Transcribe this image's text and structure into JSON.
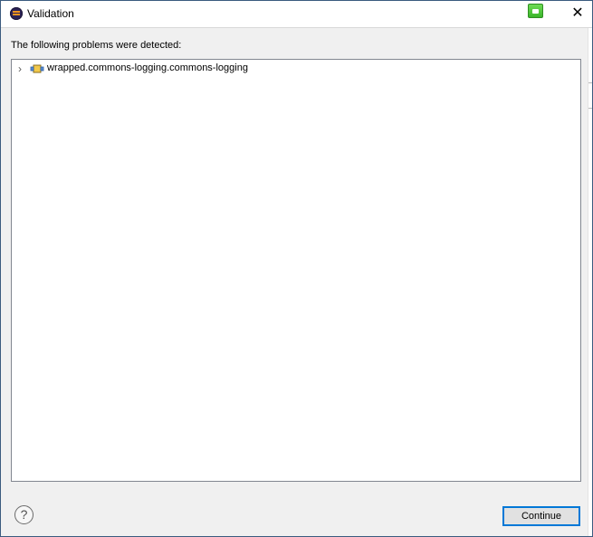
{
  "window": {
    "title": "Validation",
    "close_symbol": "✕"
  },
  "dialog": {
    "message": "The following problems were detected:"
  },
  "tree": {
    "items": [
      {
        "label": "wrapped.commons-logging.commons-logging",
        "expander": "›",
        "icon": "plugin-bundle-icon"
      }
    ]
  },
  "footer": {
    "help_symbol": "?",
    "continue_label": "Continue"
  },
  "colors": {
    "accent": "#0078d7",
    "app_icon": "#2c2255",
    "bundle_icon": "#f2c94c",
    "green_button": "#3ab52a"
  }
}
